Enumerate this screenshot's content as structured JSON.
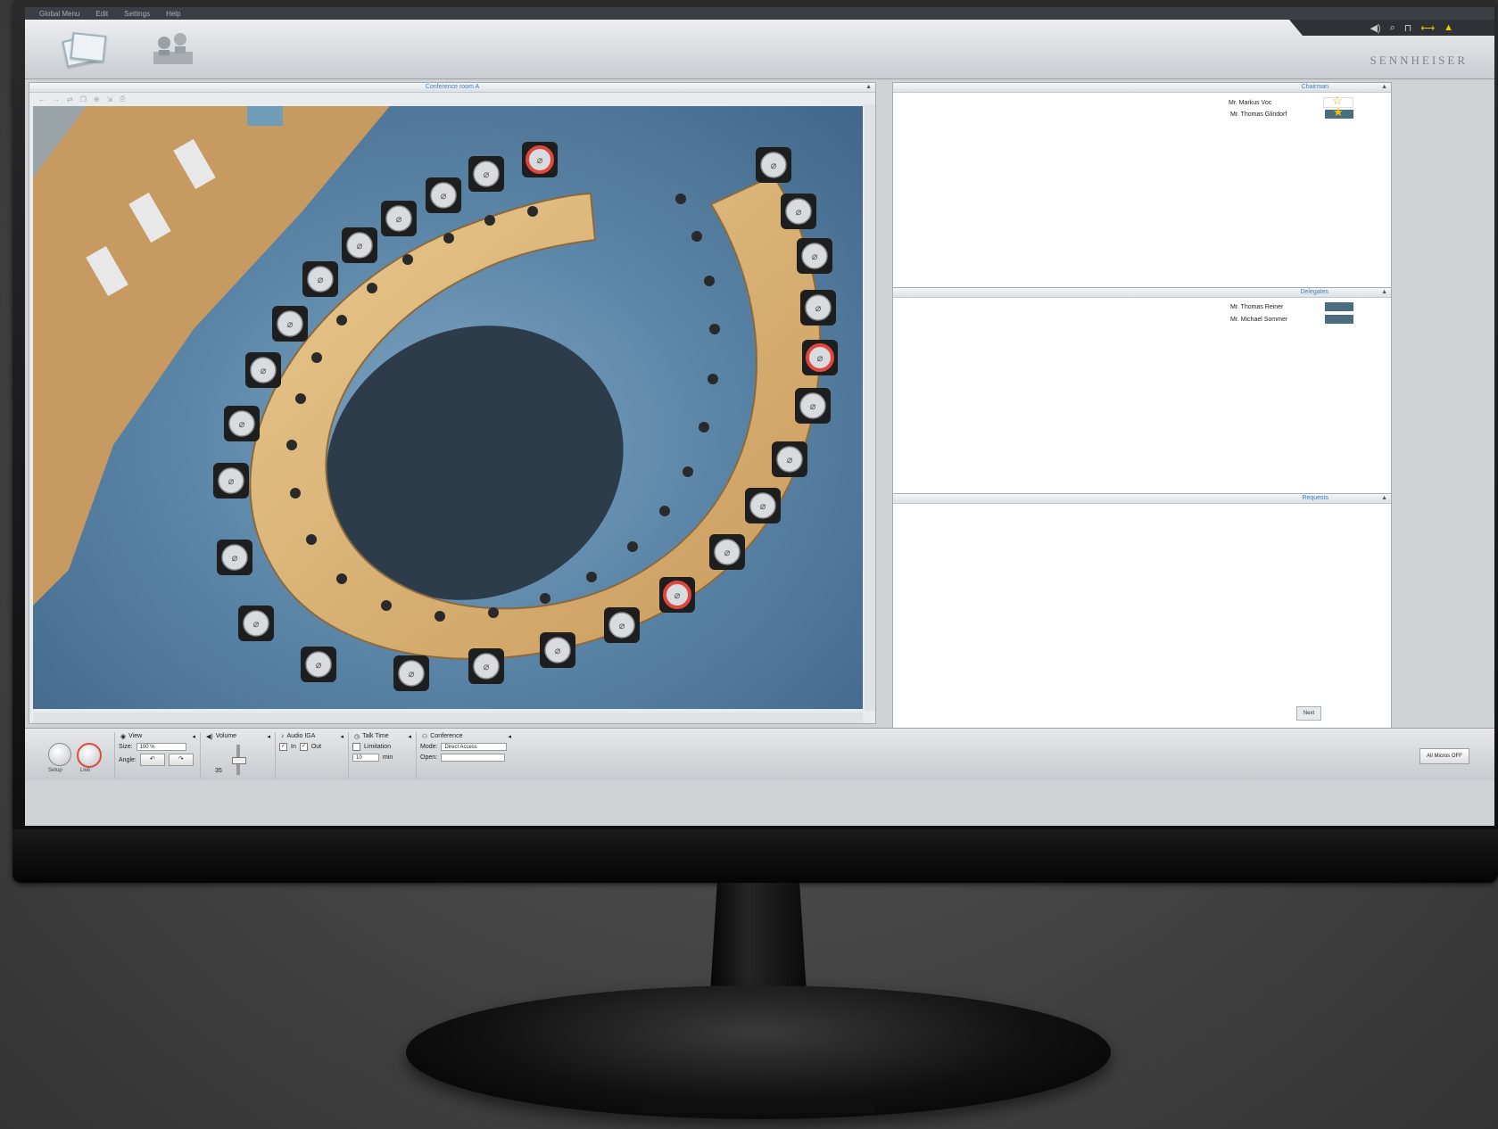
{
  "menu": [
    "Global Menu",
    "Edit",
    "Settings",
    "Help"
  ],
  "topbar": {
    "modes": [
      {
        "name": "setup-mode-icon"
      },
      {
        "name": "live-mode-icon"
      }
    ],
    "brand": "SENNHEISER",
    "status_icons": [
      "speaker-icon",
      "search-icon",
      "lock-icon",
      "link-icon",
      "warning-icon"
    ]
  },
  "conference": {
    "title": "Conference room A",
    "speaking_seats": 3,
    "request_seats": 1
  },
  "panels": {
    "chairman": {
      "title": "Chairman",
      "people": [
        {
          "name": "Mr. Markus Voc"
        },
        {
          "name": "Mr. Thomas Glindorf"
        }
      ]
    },
    "delegates": {
      "title": "Delegates",
      "people": [
        {
          "name": "Mr. Thomas Reiner"
        },
        {
          "name": "Mr. Michael Sommer"
        }
      ]
    },
    "requests": {
      "title": "Requests",
      "next": "Next"
    }
  },
  "controls": {
    "setup_label": "Setup",
    "live_label": "Live",
    "view": {
      "title": "View",
      "size_label": "Size:",
      "size_value": "100 %",
      "angle_label": "Angle:"
    },
    "volume": {
      "title": "Volume",
      "value": "35"
    },
    "audio": {
      "title": "Audio IGA",
      "in_label": "In",
      "out_label": "Out"
    },
    "talk_time": {
      "title": "Talk Time",
      "limitation_label": "Limitation",
      "value": "10",
      "unit": "min"
    },
    "conference": {
      "title": "Conference",
      "mode_label": "Mode:",
      "mode_value": "Direct Access",
      "open_label": "Open:"
    },
    "all_off": "All Micros OFF"
  },
  "colors": {
    "accent": "#3c7dc4",
    "speaking": "#e0473d",
    "badge": "#4c6d80",
    "star": "#f3c300"
  }
}
